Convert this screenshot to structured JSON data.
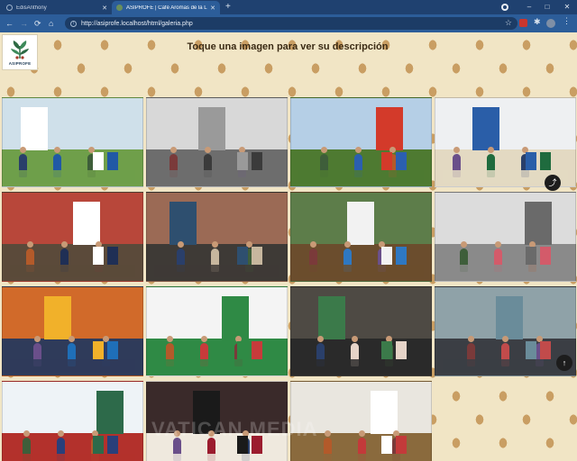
{
  "browser": {
    "tabs": [
      {
        "title": "EdisAnthony",
        "active": false
      },
      {
        "title": "ASIPROFE | Café Aromas de la L",
        "active": true
      }
    ],
    "new_tab_symbol": "+",
    "url": "http://asiprofe.localhost/html/galeria.php",
    "window_controls": [
      "–",
      "□",
      "✕"
    ]
  },
  "page": {
    "logo_text": "ASIPROFE",
    "heading": "Toque una imagen para ver su descripción",
    "watermark": "VATICAN MEDIA",
    "colors": {
      "background": "#f1e5c5",
      "bean": "#c99e63",
      "accent": "#1f6fa8"
    }
  },
  "gallery": [
    {
      "scene": "outdoor product stand with blue coffee bags",
      "bg": "#cfe0ea",
      "floor": "#6f9f4a",
      "accent": "#2159a5",
      "banner": "#ffffff"
    },
    {
      "scene": "group photo in conference hall",
      "bg": "#d8d8d8",
      "floor": "#6d6d6d",
      "accent": "#3b3b3b",
      "banner": "#9a9a9a"
    },
    {
      "scene": "coffee bags display with red and blue packages",
      "bg": "#b5cfe6",
      "floor": "#4e7a31",
      "accent": "#2b5fb0",
      "banner": "#d33a2a"
    },
    {
      "scene": "ASIPROFE booth at fair",
      "bg": "#eef0f2",
      "floor": "#e3d9c2",
      "accent": "#1f6b3e",
      "banner": "#2a5ea8"
    },
    {
      "scene": "four women at ASIPROFE stand",
      "bg": "#b8473a",
      "floor": "#5b4a3a",
      "accent": "#1f2f55",
      "banner": "#ffffff"
    },
    {
      "scene": "people at exhibition with banner",
      "bg": "#9b6a55",
      "floor": "#3e3a36",
      "accent": "#c7b79e",
      "banner": "#2e4f6f"
    },
    {
      "scene": "man with coffee products and ASIPROFE banner",
      "bg": "#5d7d4a",
      "floor": "#6b4d2d",
      "accent": "#2e78c2",
      "banner": "#f2f2f2"
    },
    {
      "scene": "people standing in lobby",
      "bg": "#dcdcdc",
      "floor": "#8a8a8a",
      "accent": "#d35b6a",
      "banner": "#6a6a6a"
    },
    {
      "scene": "two men in TV studio",
      "bg": "#d16a2a",
      "floor": "#2f3b5a",
      "accent": "#1f6fb8",
      "banner": "#f1b12a"
    },
    {
      "scene": "green canopy at market",
      "bg": "#f4f4f4",
      "floor": "#2f8a45",
      "accent": "#c73b3b",
      "banner": "#2f8a45"
    },
    {
      "scene": "two women with banners indoors",
      "bg": "#4e4a44",
      "floor": "#2a2a2a",
      "accent": "#e6d4c8",
      "banner": "#3b7a4a"
    },
    {
      "scene": "large group indoors",
      "bg": "#8fa2a8",
      "floor": "#3b3e44",
      "accent": "#c14b4b",
      "banner": "#6a8c9a"
    },
    {
      "scene": "woman at table with products",
      "bg": "#eef3f7",
      "floor": "#b3312c",
      "accent": "#2a3f7a",
      "banner": "#2d6a4a"
    },
    {
      "scene": "Pope with bishop",
      "bg": "#3a2a2a",
      "floor": "#efe9de",
      "accent": "#9b1c2e",
      "banner": "#1a1a1a"
    },
    {
      "scene": "coffee products on table",
      "bg": "#e9e6df",
      "floor": "#8a6a3d",
      "accent": "#c33a3a",
      "banner": "#ffffff"
    }
  ],
  "actions": {
    "share_icon": "⤴",
    "scroll_top_icon": "↑"
  }
}
